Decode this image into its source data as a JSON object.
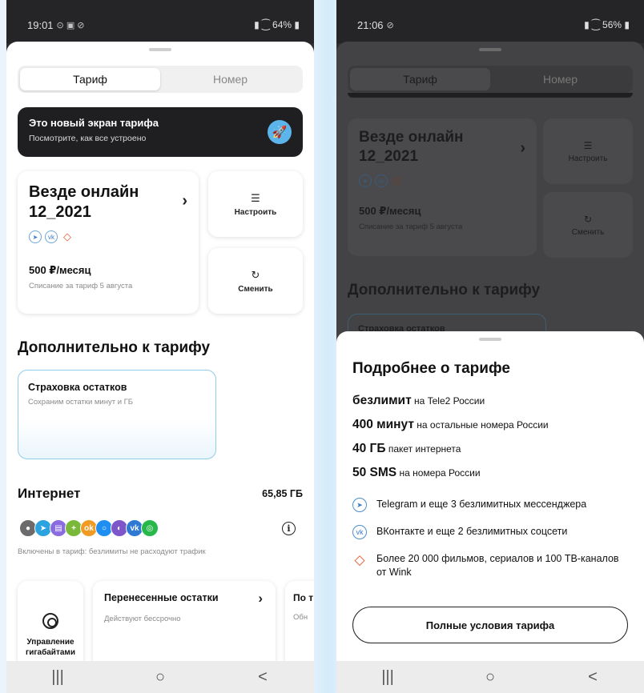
{
  "left": {
    "status": {
      "time": "19:01",
      "icons": "⊙ ▣ ⊘",
      "right": "64%"
    },
    "tabs": [
      {
        "label": "Тариф",
        "active": true
      },
      {
        "label": "Номер",
        "active": false
      }
    ],
    "promo": {
      "title": "Это новый экран тарифа",
      "subtitle": "Посмотрите, как все устроено",
      "icon": "rocket-icon"
    },
    "tariff": {
      "name": "Везде онлайн 12_2021",
      "price": "500 ₽/месяц",
      "note": "Списание за тариф 5 августа"
    },
    "actions": {
      "configure": "Настроить",
      "change": "Сменить"
    },
    "extra_title": "Дополнительно к тарифу",
    "insurance": {
      "title": "Страховка остатков",
      "subtitle": "Сохраним остатки минут и ГБ"
    },
    "internet": {
      "title": "Интернет",
      "amount": "65,85 ГБ",
      "note": "Включены в тариф: безлимиты не расходуют трафик"
    },
    "cards": {
      "gb_label": "Управление гигабайтами",
      "remainders_title": "Перенесенные остатки",
      "remainders_sub": "Действуют бессрочно",
      "next_title": "По т",
      "next_sub": "Обн"
    }
  },
  "right": {
    "status": {
      "time": "21:06",
      "icons": "⊘",
      "right": "56%"
    },
    "tabs": [
      {
        "label": "Тариф",
        "active": true
      },
      {
        "label": "Номер",
        "active": false
      }
    ],
    "tariff": {
      "name": "Везде онлайн 12_2021",
      "price": "500 ₽/месяц",
      "note": "Списание за тариф 5 августа"
    },
    "actions": {
      "configure": "Настроить",
      "change": "Сменить"
    },
    "extra_title": "Дополнительно к тарифу",
    "partial_card": "Страховка остатков",
    "sheet": {
      "title": "Подробнее о тарифе",
      "features": [
        {
          "bold": "безлимит",
          "rest": "на Tele2 России"
        },
        {
          "bold": "400 минут",
          "rest": "на остальные номера России"
        },
        {
          "bold": "40 ГБ",
          "rest": "пакет интернета"
        },
        {
          "bold": "50 SMS",
          "rest": "на номера России"
        }
      ],
      "services": [
        "Telegram и еще 3 безлимитных мессенджера",
        "ВКонтакте и еще 2 безлимитных соцсети",
        "Более 20 000 фильмов, сериалов и 100 ТВ-каналов от Wink"
      ],
      "button": "Полные условия тарифа"
    }
  },
  "nav": {
    "recents": "|||",
    "home": "○",
    "back": "<"
  },
  "colors": {
    "accent": "#5bb4ea",
    "dark": "#1f1f21",
    "wink": "#ea5a2a",
    "border_blue": "#8fcdea"
  }
}
